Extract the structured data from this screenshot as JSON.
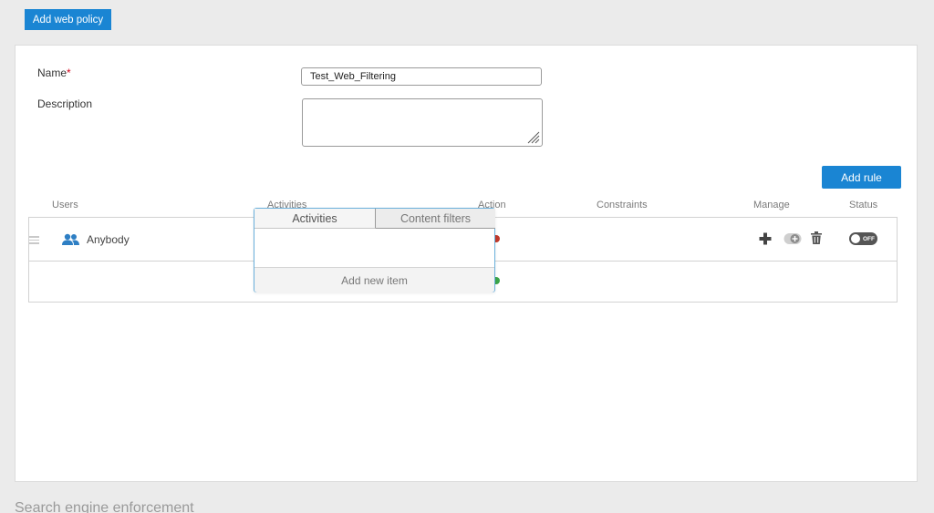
{
  "header": {
    "add_policy_label": "Add web policy"
  },
  "form": {
    "name_label": "Name",
    "required_mark": "*",
    "name_value": "Test_Web_Filtering",
    "description_label": "Description",
    "description_value": ""
  },
  "rules": {
    "add_rule_label": "Add rule",
    "columns": [
      "Users",
      "Activities",
      "Action",
      "Constraints",
      "Manage",
      "Status"
    ],
    "row": {
      "user": "Anybody",
      "status": "OFF"
    }
  },
  "popover": {
    "tabs": [
      "Activities",
      "Content filters"
    ],
    "active_tab": "Activities",
    "footer_label": "Add new item"
  },
  "next_section": {
    "title": "Search engine enforcement"
  },
  "colors": {
    "accent": "#1a85d3",
    "users_icon": "#2e7fc4",
    "deny_dot": "#c0392b",
    "allow_dot": "#3aa54a"
  },
  "icons": {
    "drag": "drag-handle-icon",
    "users": "users-group-icon",
    "plus": "plus-icon",
    "toggle": "toggle-add-icon",
    "trash": "trash-icon"
  }
}
